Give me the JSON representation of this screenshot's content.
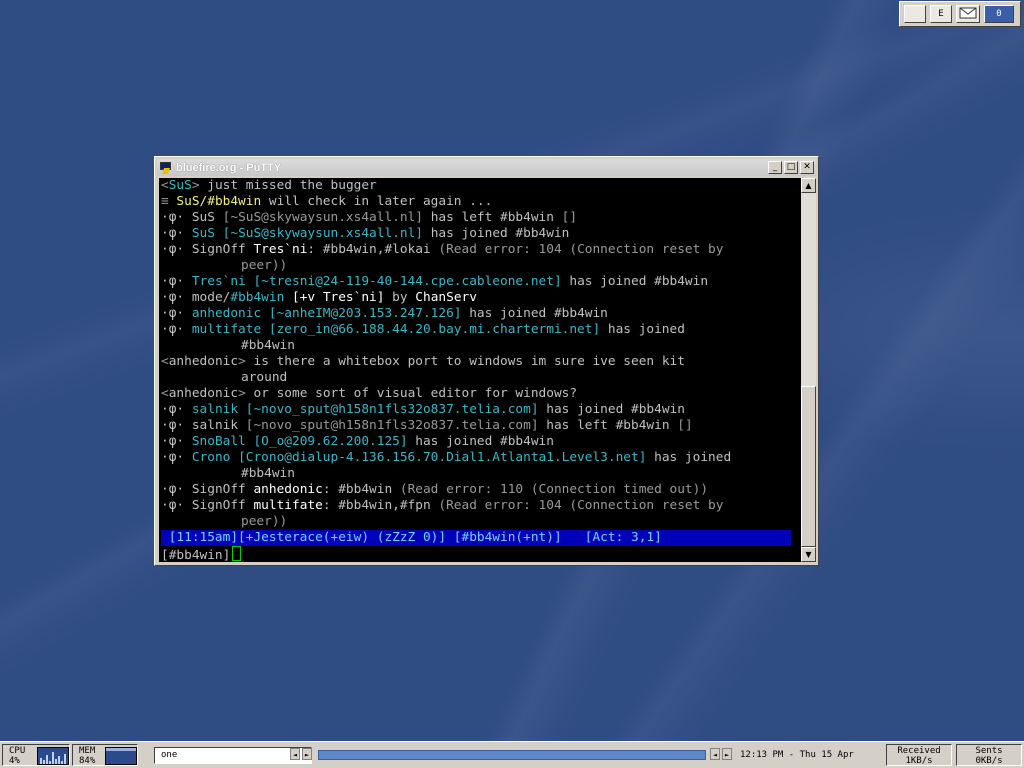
{
  "colors": {
    "desktop": "#2f4c83",
    "terminal_bg": "#000000",
    "status_bar": "#0000b8",
    "cursor": "#00d000"
  },
  "tray": {
    "buttons": [
      "",
      "E",
      "mail-icon",
      "0"
    ]
  },
  "window": {
    "title": "bluefire.org - PuTTY",
    "minimize": "_",
    "maximize": "□",
    "close": "✕"
  },
  "terminal": {
    "l1": {
      "a": "<",
      "nick": "SuS",
      "b": ">",
      "msg": " just missed the bugger"
    },
    "l2": {
      "bullet": "≡ ",
      "target": "SuS/#bb4win",
      "msg": " will check in later again ..."
    },
    "l3": {
      "prefix": "·φ· ",
      "nick": "SuS",
      "host": " [~SuS@skywaysun.xs4all.nl]",
      "msg": " has left #bb4win",
      "tail": " []"
    },
    "l4": {
      "prefix": "·φ· ",
      "nick": "SuS",
      "host": " [~SuS@skywaysun.xs4all.nl]",
      "msg": " has joined #bb4win"
    },
    "l5": {
      "prefix": "·φ· ",
      "what": "SignOff ",
      "nick": "Tres`ni",
      "msg": ": #bb4win,#lokai ",
      "err": "(Read error: 104 (Connection reset by"
    },
    "l5b": {
      "err": "peer))"
    },
    "l6": {
      "prefix": "·φ· ",
      "nick": "Tres`ni",
      "host": " [~tresni@24-119-40-144.cpe.cableone.net]",
      "msg": " has joined #bb4win"
    },
    "l7": {
      "prefix": "·φ· ",
      "what": "mode/",
      "chan": "#bb4win",
      "mode": " [+v Tres`ni]",
      "msg": " by ",
      "by": "ChanServ"
    },
    "l8": {
      "prefix": "·φ· ",
      "nick": "anhedonic",
      "host": " [~anheIM@203.153.247.126]",
      "msg": " has joined #bb4win"
    },
    "l9": {
      "prefix": "·φ· ",
      "nick": "multifate",
      "host": " [zero_in@66.188.44.20.bay.mi.chartermi.net]",
      "msg": " has joined"
    },
    "l9b": {
      "msg": "#bb4win"
    },
    "l10": {
      "a": "<",
      "nick": "anhedonic",
      "b": ">",
      "msg": " is there a whitebox port to windows im sure ive seen kit"
    },
    "l10b": {
      "msg": "around"
    },
    "l11": {
      "a": "<",
      "nick": "anhedonic",
      "b": ">",
      "msg": " or some sort of visual editor for windows?"
    },
    "l12": {
      "prefix": "·φ· ",
      "nick": "salnik",
      "host": " [~novo_sput@h158n1fls32o837.telia.com]",
      "msg": " has joined #bb4win"
    },
    "l13": {
      "prefix": "·φ· ",
      "nick": "salnik",
      "host": " [~novo_sput@h158n1fls32o837.telia.com]",
      "msg": " has left #bb4win",
      "tail": " []"
    },
    "l14": {
      "prefix": "·φ· ",
      "nick": "SnoBall",
      "host": " [O_o@209.62.200.125]",
      "msg": " has joined #bb4win"
    },
    "l15": {
      "prefix": "·φ· ",
      "nick": "Crono",
      "host": " [Crono@dialup-4.136.156.70.Dial1.Atlanta1.Level3.net]",
      "msg": " has joined"
    },
    "l15b": {
      "msg": "#bb4win"
    },
    "l16": {
      "prefix": "·φ· ",
      "what": "SignOff ",
      "nick": "anhedonic",
      "msg": ": #bb4win ",
      "err": "(Read error: 110 (Connection timed out))"
    },
    "l17": {
      "prefix": "·φ· ",
      "what": "SignOff ",
      "nick": "multifate",
      "msg": ": #bb4win,#fpn ",
      "err": "(Read error: 104 (Connection reset by"
    },
    "l17b": {
      "err": "peer))"
    }
  },
  "status_bar": {
    "time": " [11:15am]",
    "user": "[+Jesterace(+eiw)",
    "away": " (zZzZ 0)]",
    "chan": " [#bb4win(+nt)]",
    "act": "   [Act: 3,1]"
  },
  "prompt": "[#bb4win]",
  "taskbar": {
    "cpu_label": "CPU",
    "cpu_value": "4%",
    "mem_label": "MEM",
    "mem_value": "84%",
    "desktop_name": "one",
    "clock": "12:13 PM - Thu 15 Apr",
    "received_label": "Received",
    "received_value": "1KB/s",
    "sent_label": "Sents",
    "sent_value": "0KB/s"
  }
}
